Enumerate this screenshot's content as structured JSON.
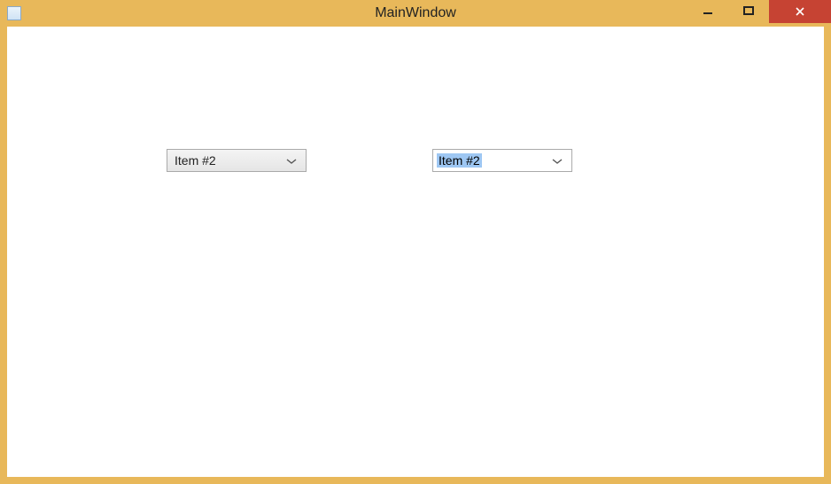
{
  "window": {
    "title": "MainWindow"
  },
  "combos": {
    "readonly": {
      "selected": "Item #2"
    },
    "editable": {
      "selected": "Item #2"
    }
  }
}
